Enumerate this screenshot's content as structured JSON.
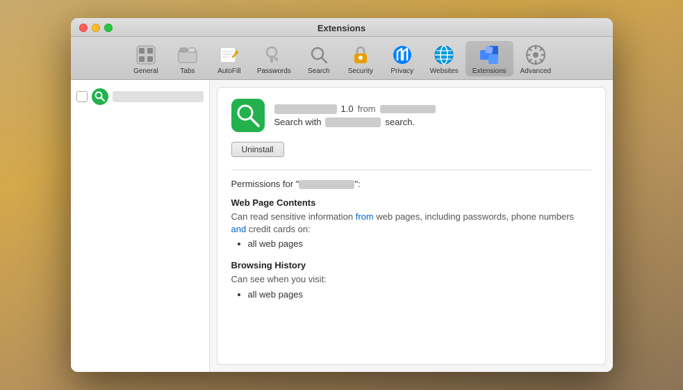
{
  "window": {
    "title": "Extensions"
  },
  "toolbar": {
    "items": [
      {
        "id": "general",
        "label": "General",
        "icon": "⬜"
      },
      {
        "id": "tabs",
        "label": "Tabs",
        "icon": "🗂"
      },
      {
        "id": "autofill",
        "label": "AutoFill",
        "icon": "✏️"
      },
      {
        "id": "passwords",
        "label": "Passwords",
        "icon": "🔑"
      },
      {
        "id": "search",
        "label": "Search",
        "icon": "🔍"
      },
      {
        "id": "security",
        "label": "Security",
        "icon": "🔒"
      },
      {
        "id": "privacy",
        "label": "Privacy",
        "icon": "✋"
      },
      {
        "id": "websites",
        "label": "Websites",
        "icon": "🌐"
      },
      {
        "id": "extensions",
        "label": "Extensions",
        "icon": "⚡"
      },
      {
        "id": "advanced",
        "label": "Advanced",
        "icon": "⚙️"
      }
    ]
  },
  "extension": {
    "version_label": "1.0",
    "from_text": "from",
    "search_prefix": "Search with",
    "search_suffix": "search.",
    "uninstall_button": "Uninstall",
    "permissions_prefix": "Permissions for \"",
    "permissions_suffix": "\":",
    "sections": [
      {
        "title": "Web Page Contents",
        "description_parts": [
          {
            "text": "Can read sensitive information ",
            "highlight": false
          },
          {
            "text": "from",
            "highlight": true
          },
          {
            "text": " web pages, including passwords, phone numbers ",
            "highlight": false
          },
          {
            "text": "and",
            "highlight": true
          },
          {
            "text": " credit cards on:",
            "highlight": false
          }
        ],
        "list_items": [
          "all web pages"
        ]
      },
      {
        "title": "Browsing History",
        "description_parts": [
          {
            "text": "Can see when you visit:",
            "highlight": false
          }
        ],
        "list_items": [
          "all web pages"
        ]
      }
    ]
  }
}
